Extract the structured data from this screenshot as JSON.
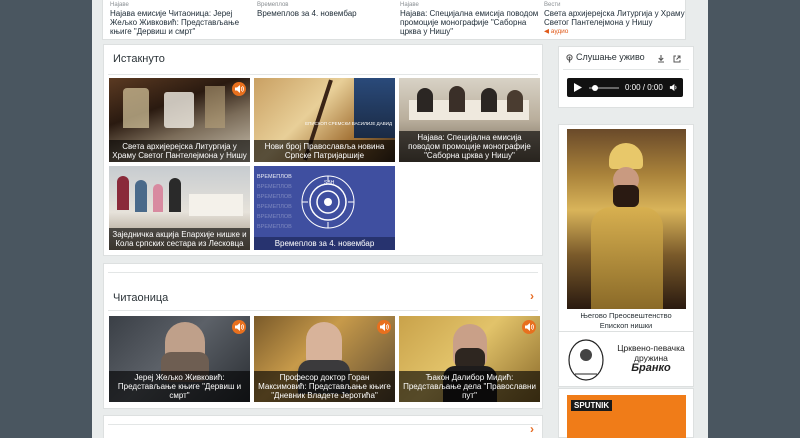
{
  "top_news": [
    {
      "category": "Најаве",
      "title": "Најава емисије Читаоница: Јереј Жељко Живковић: Представљање књиге \"Дервиш и смрт\"",
      "audio": ""
    },
    {
      "category": "Времеплов",
      "title": "Времеплов за 4. новембар",
      "audio": ""
    },
    {
      "category": "Најаве",
      "title": "Најава: Специјална емисија поводом промоције монографије \"Саборна црква у Нишу\"",
      "audio": ""
    },
    {
      "category": "Вести",
      "title": "Света архијерејска Литургија у Храму Светог Пантелејмона у Нишу",
      "audio": "◀ аудио"
    }
  ],
  "featured": {
    "title": "Истакнуто",
    "cards": [
      {
        "caption": "Света архијерејска Литургија у Храму Светог Пантелејмона у Нишу",
        "audio": true
      },
      {
        "caption": "Нови број Православља новина Српске Патријаршије",
        "audio": false,
        "overlay": "ЕПИСКОП СРЕМСКИ ВАСИЛИЈЕ ДАВИД"
      },
      {
        "caption": "Најава: Специјална емисија поводом промоције монографије \"Саборна црква у Нишу\"",
        "audio": false
      },
      {
        "caption": "Заједничка акција Епархије нишке и Кола српских сестара из Лесковца",
        "audio": false
      },
      {
        "caption": "Времеплов за 4. новембар",
        "audio": false,
        "word": "ВРЕМЕПЛОВ",
        "logo": "SBH"
      }
    ]
  },
  "reading": {
    "title": "Читаоница",
    "cards": [
      {
        "caption": "Јереј Жељко Живковић: Представљање књиге \"Дервиш и смрт\"",
        "audio": true
      },
      {
        "caption": "Професор доктор Горан Максимовић: Представљање књиге \"Дневник Владете Јеротића\"",
        "audio": true
      },
      {
        "caption": "Ђакон Далибор Мидић: Представљање дела \"Православни пут\"",
        "audio": true
      }
    ]
  },
  "live": {
    "title": "Слушање уживо",
    "time": "0:00 / 0:00"
  },
  "bishop": {
    "name": "Његово Преосвештенство",
    "title": "Епископ нишки"
  },
  "choir": {
    "line1": "Црквено-певачка",
    "line2": "дружина",
    "line3": "Бранко"
  },
  "sputnik": {
    "label": "SPUTNIK"
  },
  "colors": {
    "accent": "#e66b23",
    "page_bg": "#e9ecec",
    "frame_bg": "#4a5660"
  }
}
